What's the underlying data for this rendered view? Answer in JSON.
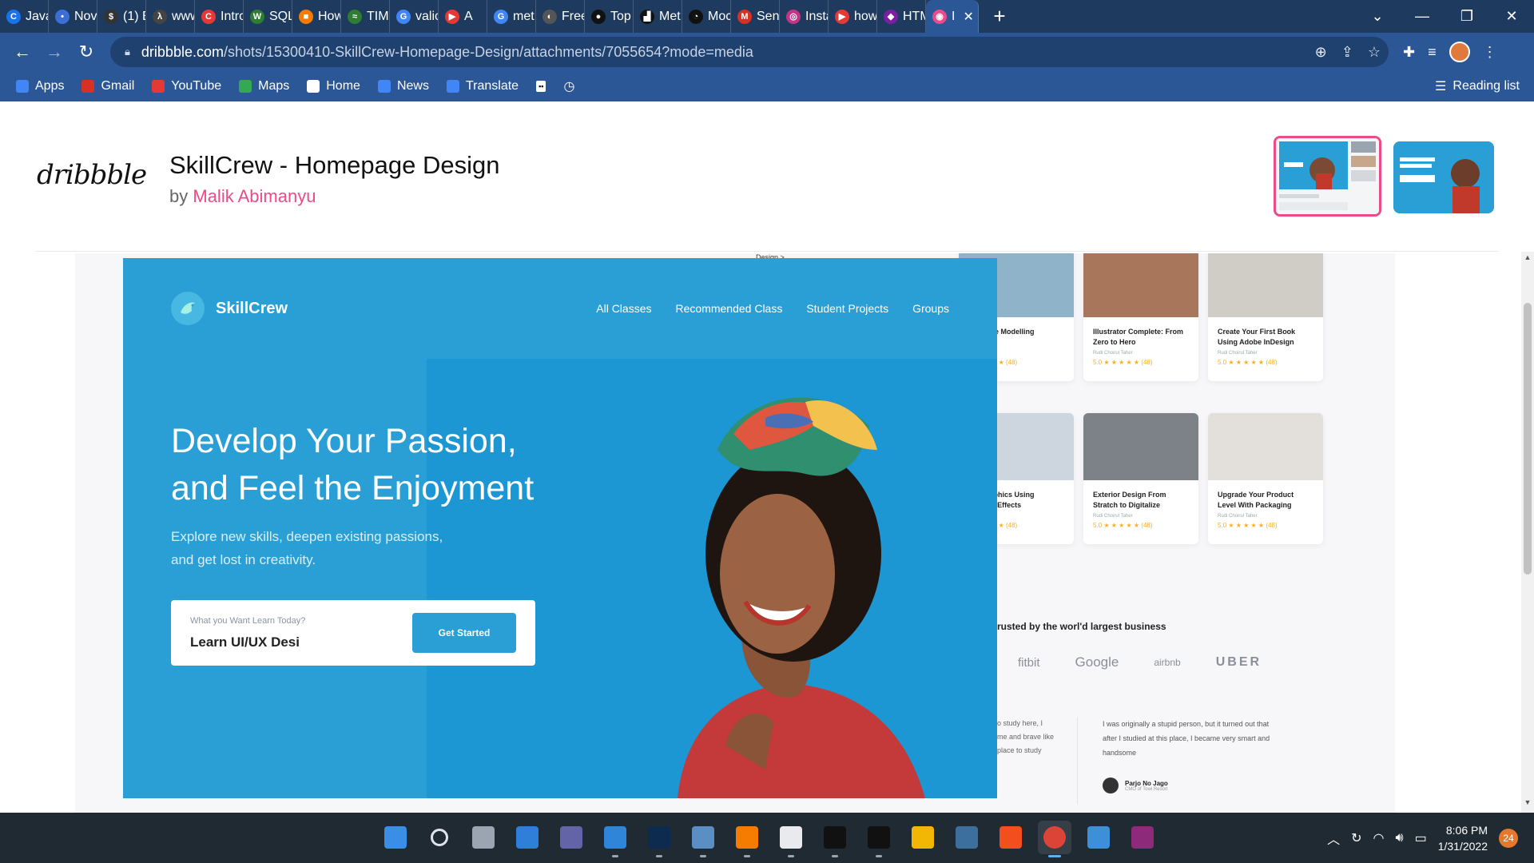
{
  "browser": {
    "tabs": [
      {
        "label": "Java",
        "color": "#1a73e8",
        "glyph": "C"
      },
      {
        "label": "Nov",
        "color": "#3c6fd6",
        "glyph": "•"
      },
      {
        "label": "(1) E",
        "color": "#333333",
        "glyph": "$"
      },
      {
        "label": "www",
        "color": "#444444",
        "glyph": "λ"
      },
      {
        "label": "Intro",
        "color": "#e53935",
        "glyph": "C"
      },
      {
        "label": "SQL",
        "color": "#2e7d32",
        "glyph": "W"
      },
      {
        "label": "How",
        "color": "#f57c00",
        "glyph": "■"
      },
      {
        "label": "TIMI",
        "color": "#2e7d32",
        "glyph": "≈"
      },
      {
        "label": "valic",
        "color": "#4285f4",
        "glyph": "G"
      },
      {
        "label": "A",
        "color": "#e53935",
        "glyph": "▶"
      },
      {
        "label": "met",
        "color": "#4285f4",
        "glyph": "G"
      },
      {
        "label": "Free",
        "color": "#555555",
        "glyph": "◐"
      },
      {
        "label": "Top",
        "color": "#111111",
        "glyph": "●"
      },
      {
        "label": "Met",
        "color": "#111111",
        "glyph": "▟"
      },
      {
        "label": "Moc",
        "color": "#111111",
        "glyph": "◔"
      },
      {
        "label": "Sent",
        "color": "#d93025",
        "glyph": "M"
      },
      {
        "label": "Insta",
        "color": "#c13584",
        "glyph": "◎"
      },
      {
        "label": "how",
        "color": "#e53935",
        "glyph": "▶"
      },
      {
        "label": "HTM",
        "color": "#7b1fa2",
        "glyph": "◆"
      },
      {
        "label": "I",
        "color": "#ea4c89",
        "glyph": "◉",
        "active": true
      }
    ],
    "new_tab": "+",
    "url_host": "dribbble.com",
    "url_path": "/shots/15300410-SkillCrew-Homepage-Design/attachments/7055654?mode=media",
    "bookmarks": [
      {
        "label": "Apps",
        "color": "#4285f4"
      },
      {
        "label": "Gmail",
        "color": "#d93025"
      },
      {
        "label": "YouTube",
        "color": "#e53935"
      },
      {
        "label": "Maps",
        "color": "#34a853"
      },
      {
        "label": "Home",
        "color": "#ffffff"
      },
      {
        "label": "News",
        "color": "#4285f4"
      },
      {
        "label": "Translate",
        "color": "#4285f4"
      }
    ],
    "reading_list": "Reading list"
  },
  "shot": {
    "logo": "dribbble",
    "title": "SkillCrew - Homepage Design",
    "by": "by",
    "author": "Malik Abimanyu"
  },
  "design": {
    "brand": "SkillCrew",
    "nav": [
      "All Classes",
      "Recommended Class",
      "Student Projects",
      "Groups"
    ],
    "headline_1": "Develop Your Passion,",
    "headline_2": "and Feel the Enjoyment",
    "sub_1": "Explore new skills, deepen existing passions,",
    "sub_2": "and get lost in creativity.",
    "search_label": "What you Want Learn Today?",
    "search_value": "Learn UI/UX Desi",
    "cta": "Get Started",
    "top_stub": "Design  >",
    "courses": [
      {
        "title": "hitecture Modelling\nng Revit",
        "author": "Choirul Taher",
        "rating": "★ ★ ★ ★ ★ (48)",
        "img": "#8fb4c9"
      },
      {
        "title": "Illustrator Complete: From\nZero to Hero",
        "author": "Rudi Choirul Taher",
        "rating": "5.0 ★ ★ ★ ★ ★ (48)",
        "img": "#a8765a"
      },
      {
        "title": "Create Your First Book\nUsing Adobe InDesign",
        "author": "Rudi Choirul Taher",
        "rating": "5.0 ★ ★ ★ ★ ★ (48)",
        "img": "#d0ccc6"
      },
      {
        "title": "ion Graphics Using\nbe After Effects",
        "author": "Choirul Taher",
        "rating": "★ ★ ★ ★ ★ (48)",
        "img": "#cdd6de"
      },
      {
        "title": "Exterior Design From\nStratch to Digitalize",
        "author": "Rudi Choirul Taher",
        "rating": "5.0 ★ ★ ★ ★ ★ (48)",
        "img": "#7d8289"
      },
      {
        "title": "Upgrade Your Product\nLevel With Packaging",
        "author": "Rudi Choirul Taher",
        "rating": "5.0 ★ ★ ★ ★ ★ (48)",
        "img": "#e3e0dc"
      }
    ],
    "trusted": "rusted by the worl'd largest business",
    "logos": [
      "fitbit",
      "Google",
      "airbnb",
      "UBER"
    ],
    "testimonial_left": "o study here, I\nme and brave like\nplace to study",
    "testimonial_right": "I was originally a stupid person, but it turned out that after I studied at this place, I became very smart and handsome",
    "testimonial_name": "Parjo No Jago",
    "testimonial_role": "CMO of Towl Resort"
  },
  "taskbar": {
    "apps": [
      {
        "name": "start",
        "color": "#3b8ee8"
      },
      {
        "name": "search",
        "color": "#dfe4ea"
      },
      {
        "name": "task-view",
        "color": "#9aa5b1"
      },
      {
        "name": "widgets",
        "color": "#2f7fd8"
      },
      {
        "name": "teams-chat",
        "color": "#6264a7"
      },
      {
        "name": "vscode",
        "color": "#2f86d8",
        "running": true
      },
      {
        "name": "photoshop",
        "color": "#0c2b4e",
        "running": true
      },
      {
        "name": "resource-monitor",
        "color": "#5b8fc4",
        "running": true
      },
      {
        "name": "xampp",
        "color": "#f57c00",
        "running": true
      },
      {
        "name": "slack",
        "color": "#e8eaed",
        "running": true
      },
      {
        "name": "terminal",
        "color": "#111111",
        "running": true
      },
      {
        "name": "command-prompt",
        "color": "#111111",
        "running": true
      },
      {
        "name": "file-explorer",
        "color": "#f2b705"
      },
      {
        "name": "remote-desktop",
        "color": "#3d6f9c"
      },
      {
        "name": "figma",
        "color": "#f24e1e"
      },
      {
        "name": "chrome",
        "color": "#db4437",
        "running": true,
        "focused": true
      },
      {
        "name": "photos",
        "color": "#3c8fd8"
      },
      {
        "name": "winrar",
        "color": "#8e2a7a"
      }
    ],
    "time": "8:06 PM",
    "date": "1/31/2022",
    "notifications": "24"
  }
}
